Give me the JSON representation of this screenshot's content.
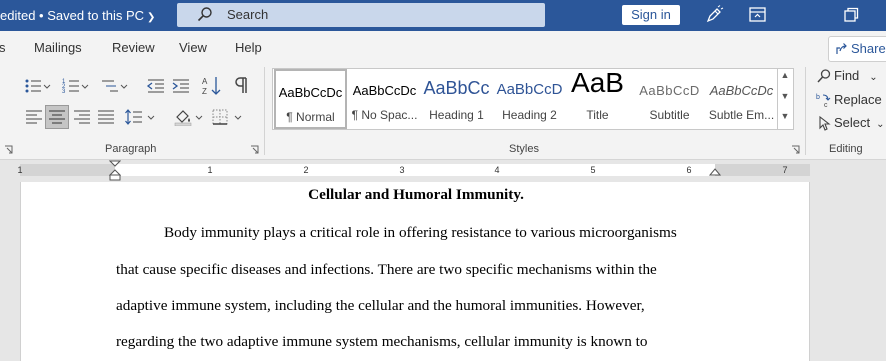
{
  "titlebar": {
    "doc_status": "edited • Saved to this PC",
    "search_placeholder": "Search",
    "signin_label": "Sign in"
  },
  "menu": {
    "tabs": [
      "s",
      "Mailings",
      "Review",
      "View",
      "Help"
    ],
    "share_label": "Share"
  },
  "ribbon": {
    "paragraph_label": "Paragraph",
    "styles_label": "Styles",
    "editing_label": "Editing",
    "styles": [
      {
        "sample": "AaBbCcDc",
        "name": "¶ Normal",
        "selected": true
      },
      {
        "sample": "AaBbCcDc",
        "name": "¶ No Spac..."
      },
      {
        "sample": "AaBbCc",
        "name": "Heading 1"
      },
      {
        "sample": "AaBbCcD",
        "name": "Heading 2"
      },
      {
        "sample": "AaB",
        "name": "Title"
      },
      {
        "sample": "AaBbCcD",
        "name": "Subtitle"
      },
      {
        "sample": "AaBbCcDc",
        "name": "Subtle Em..."
      }
    ],
    "editing": {
      "find": "Find",
      "replace": "Replace",
      "select": "Select"
    }
  },
  "ruler": {
    "numbers": [
      "1",
      "1",
      "2",
      "3",
      "4",
      "5",
      "6",
      "7"
    ]
  },
  "document": {
    "title": "Cellular and Humoral Immunity.",
    "lines": [
      "Body immunity plays a critical role in offering resistance to various microorganisms",
      "that cause specific diseases and infections. There are two specific mechanisms within the",
      "adaptive immune system, including the cellular and the humoral immunities. However,",
      "regarding the two adaptive immune system mechanisms, cellular immunity is known to"
    ]
  },
  "colors": {
    "titlebar": "#2b579a",
    "ribbon": "#f3f3f3",
    "heading_blue": "#2f5496"
  }
}
